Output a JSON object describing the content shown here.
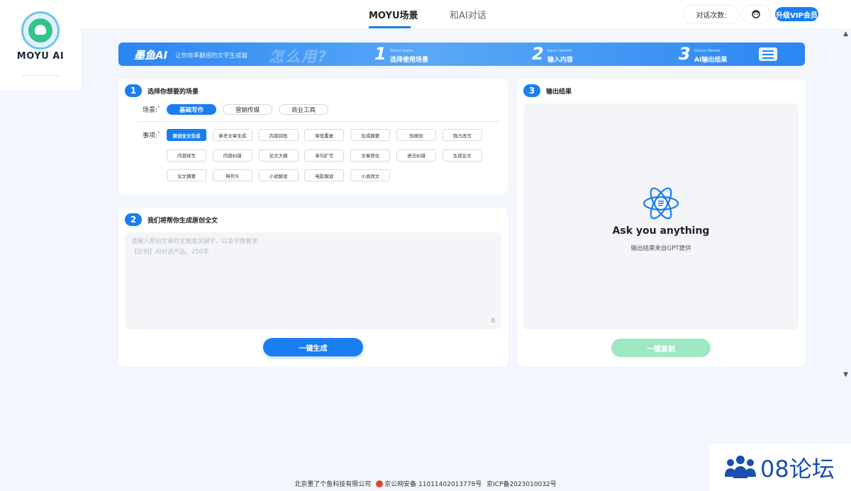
{
  "app": {
    "logo_text": "MOYU AI"
  },
  "header": {
    "tabs": [
      {
        "label": "MOYU场景",
        "active": true
      },
      {
        "label": "和AI对话",
        "active": false
      }
    ],
    "count_label": "对话次数:",
    "vip_label": "升级VIP会员"
  },
  "banner": {
    "brand": "墨鱼AI",
    "tagline": "让你效率翻倍的文字生成器",
    "how_to": "怎么用?",
    "steps": [
      {
        "num": "1",
        "en": "Select Scene",
        "cn": "选择使用场景"
      },
      {
        "num": "2",
        "en": "Input Content",
        "cn": "输入内容"
      },
      {
        "num": "3",
        "en": "Output Results",
        "cn": "AI输出结果"
      }
    ]
  },
  "scene_card": {
    "step": "1",
    "title": "选择你想要的场景",
    "scene_label": "场景:",
    "scenes": [
      {
        "label": "基础写作",
        "active": true
      },
      {
        "label": "营销传媒",
        "active": false
      },
      {
        "label": "商业工具",
        "active": false
      }
    ],
    "item_label": "事项:",
    "items": [
      {
        "label": "原创全文生成",
        "active": true
      },
      {
        "label": "参考文章生成",
        "active": false
      },
      {
        "label": "内容润色",
        "active": false
      },
      {
        "label": "降低重复",
        "active": false
      },
      {
        "label": "生成摘要",
        "active": false
      },
      {
        "label": "伪原创",
        "active": false
      },
      {
        "label": "强力改写",
        "active": false
      },
      {
        "label": "内容续写",
        "active": false
      },
      {
        "label": "内容纠错",
        "active": false
      },
      {
        "label": "论文大纲",
        "active": false
      },
      {
        "label": "单句扩写",
        "active": false
      },
      {
        "label": "文章简化",
        "active": false
      },
      {
        "label": "语法纠错",
        "active": false
      },
      {
        "label": "生成论文",
        "active": false
      },
      {
        "label": "论文摘要",
        "active": false
      },
      {
        "label": "神开头",
        "active": false
      },
      {
        "label": "小说解说",
        "active": false
      },
      {
        "label": "电影解说",
        "active": false
      },
      {
        "label": "小说改文",
        "active": false
      }
    ]
  },
  "input_card": {
    "step": "2",
    "title": "我们将帮你生成原创全文",
    "placeholder_line1": "请输入原创文章的主题或关键字、以及字数要求",
    "placeholder_line2": "【示例】AI对话产品、250字",
    "char_count": "0",
    "generate_label": "一键生成"
  },
  "output_card": {
    "step": "3",
    "title": "输出结果",
    "heading": "Ask you anything",
    "subtitle": "输出结果来自GPT提供",
    "copy_label": "一键复制"
  },
  "footer": {
    "company": "北京墨了个鱼科技有限公司",
    "police_record": "京公网安备 11011402013778号",
    "icp": "京ICP备2023010032号"
  },
  "watermark": {
    "text": "08论坛"
  },
  "colors": {
    "primary": "#1a7ef0",
    "accent_green": "#9ee8c4",
    "background": "#f3f6fc"
  }
}
